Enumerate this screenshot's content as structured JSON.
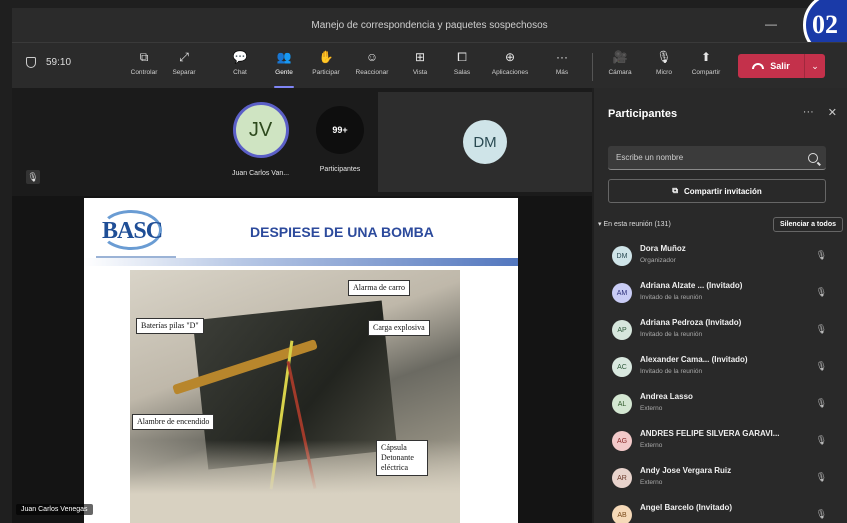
{
  "window": {
    "title": "Manejo de correspondencia y paquetes sospechosos",
    "minimize": "—",
    "corner_badge": "02"
  },
  "toolbar": {
    "timer": "59:10",
    "buttons": [
      {
        "label": "Controlar",
        "icon": "control-icon",
        "glyph": "⧉"
      },
      {
        "label": "Separar",
        "icon": "pop-out-icon",
        "glyph": "⤢"
      },
      {
        "label": "Chat",
        "icon": "chat-icon",
        "glyph": "💬"
      },
      {
        "label": "Gente",
        "icon": "people-icon",
        "glyph": "👥"
      },
      {
        "label": "Participar",
        "icon": "raise-hand-icon",
        "glyph": "✋"
      },
      {
        "label": "Reaccionar",
        "icon": "react-icon",
        "glyph": "☺"
      },
      {
        "label": "Vista",
        "icon": "view-icon",
        "glyph": "⊞"
      },
      {
        "label": "Salas",
        "icon": "rooms-icon",
        "glyph": "⧠"
      },
      {
        "label": "Aplicaciones",
        "icon": "apps-icon",
        "glyph": "⊕"
      },
      {
        "label": "Más",
        "icon": "more-icon",
        "glyph": "···"
      }
    ],
    "media": [
      {
        "label": "Cámara",
        "icon": "camera-off-icon",
        "glyph": "🎥"
      },
      {
        "label": "Micro",
        "icon": "mic-off-icon",
        "glyph": "🎙"
      },
      {
        "label": "Compartir",
        "icon": "share-icon",
        "glyph": "⬆"
      }
    ],
    "leave_label": "Salir",
    "leave_chevron": "⌄",
    "active_button": "Gente"
  },
  "gallery": {
    "mic_glyph": "🎙",
    "tiles": [
      {
        "initials": "JV",
        "name": "Juan Carlos Van..."
      },
      {
        "initials": "99+",
        "name": "Participantes"
      }
    ],
    "dm_initials": "DM"
  },
  "slide": {
    "logo": "BASC",
    "title": "DESPIESE DE UNA BOMBA",
    "callouts": {
      "alarm": "Alarma de carro",
      "batteries": "Baterías pilas \"D\"",
      "explosive": "Carga explosiva",
      "wire": "Alambre de encendido",
      "capsule": "Cápsula Detonante eléctrica"
    }
  },
  "speaker_name": "Juan Carlos Venegas",
  "panel": {
    "title": "Participantes",
    "more_glyph": "···",
    "close_glyph": "✕",
    "search_placeholder": "Escribe un nombre",
    "invite_label": "Compartir invitación",
    "invite_glyph": "⧉",
    "section_label": "▾ En esta reunión (131)",
    "mute_all_label": "Silenciar a todos",
    "participants": [
      {
        "initials": "DM",
        "name": "Dora Muñoz",
        "role": "Organizador",
        "color": "#cfe4e8",
        "fg": "#2a4a52"
      },
      {
        "initials": "AM",
        "name": "Adriana Alzate ...  (Invitado)",
        "role": "Invitado de la reunión",
        "color": "#c9ccf5",
        "fg": "#2d2f7a"
      },
      {
        "initials": "AP",
        "name": "Adriana Pedroza (Invitado)",
        "role": "Invitado de la reunión",
        "color": "#d6e6dc",
        "fg": "#2e5a3a"
      },
      {
        "initials": "AC",
        "name": "Alexander Cama... (Invitado)",
        "role": "Invitado de la reunión",
        "color": "#d9e8df",
        "fg": "#2e5a3a"
      },
      {
        "initials": "AL",
        "name": "Andrea Lasso",
        "role": "Externo",
        "color": "#d4e7d2",
        "fg": "#2e5a2a"
      },
      {
        "initials": "AG",
        "name": "ANDRES FELIPE SILVERA GARAVI...",
        "role": "Externo",
        "color": "#f2c9c9",
        "fg": "#8a2a2a"
      },
      {
        "initials": "AR",
        "name": "Andy Jose Vergara Ruiz",
        "role": "Externo",
        "color": "#e8d3cc",
        "fg": "#6a3a2a"
      },
      {
        "initials": "AB",
        "name": "Angel Barcelo (Invitado)",
        "role": "",
        "color": "#f5d9b8",
        "fg": "#7a4a1a"
      }
    ],
    "row_mic_glyph": "🎙"
  }
}
